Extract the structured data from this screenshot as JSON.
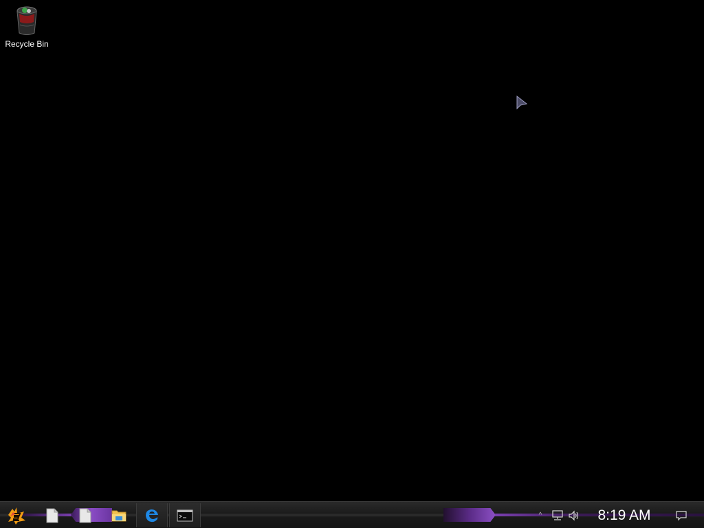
{
  "desktop": {
    "icons": [
      {
        "label": "Recycle Bin",
        "icon": "recycle-bin-icon"
      }
    ]
  },
  "taskbar": {
    "items": [
      {
        "name": "start",
        "icon": "start-logo-icon"
      },
      {
        "name": "file-1",
        "icon": "blank-file-icon"
      },
      {
        "name": "file-2",
        "icon": "blank-file-icon"
      },
      {
        "name": "file-explorer",
        "icon": "folder-icon"
      },
      {
        "name": "edge",
        "icon": "edge-browser-icon"
      },
      {
        "name": "command-prompt",
        "icon": "terminal-icon"
      }
    ],
    "tray": {
      "show_hidden": "^",
      "network_icon": "network-icon",
      "volume_icon": "volume-icon",
      "clock": "8:19 AM",
      "notifications_icon": "action-center-icon"
    }
  },
  "colors": {
    "desktop_bg": "#000000",
    "accent_purple": "#8a4cc4",
    "taskbar_bg": "#1b1b1b",
    "edge_blue": "#1e88e5"
  }
}
